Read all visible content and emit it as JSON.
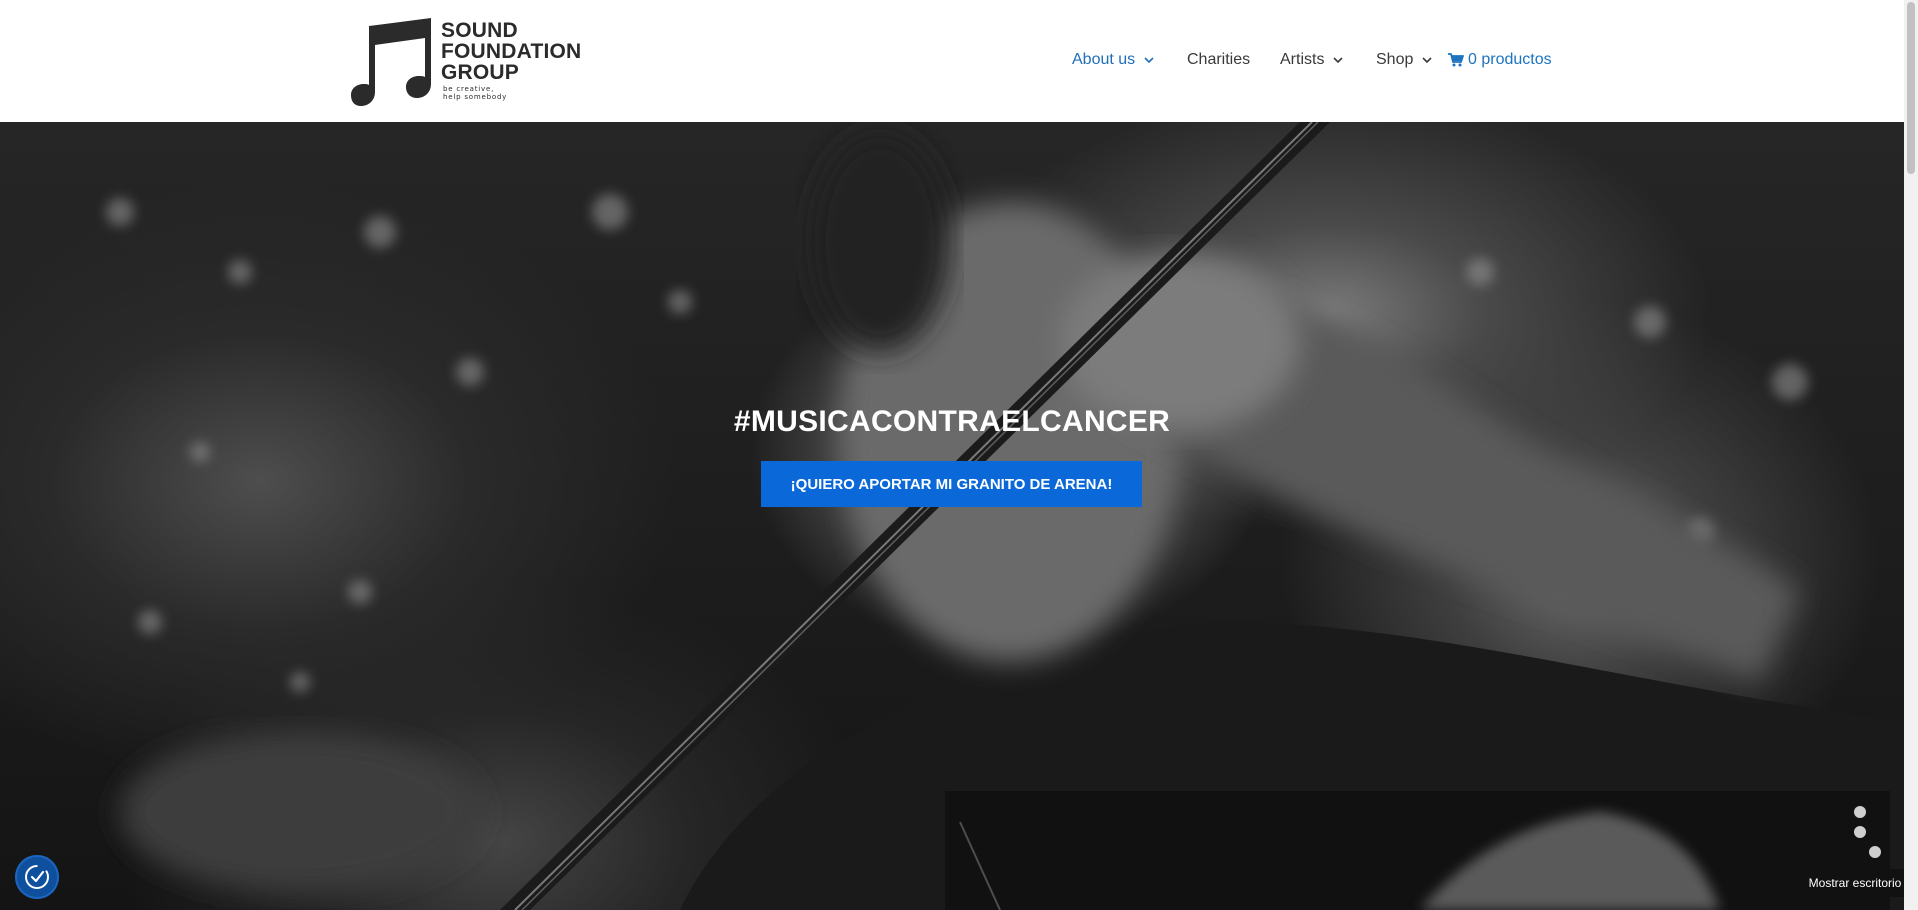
{
  "brand": {
    "name_line1": "SOUND",
    "name_line2": "FOUNDATION",
    "name_line3": "GROUP",
    "tagline_line1": "be creative,",
    "tagline_line2": "help somebody"
  },
  "nav": {
    "items": [
      {
        "label": "About us",
        "has_dropdown": true,
        "active": true
      },
      {
        "label": "Charities",
        "has_dropdown": false
      },
      {
        "label": "Artists",
        "has_dropdown": true
      },
      {
        "label": "Shop",
        "has_dropdown": true
      }
    ],
    "cart_label": "0 productos",
    "cart_icon": "shopping-cart-icon"
  },
  "hero": {
    "title": "#MUSICACONTRAELCANCER",
    "cta_label": "¡QUIERO APORTAR MI GRANITO DE ARENA!"
  },
  "widgets": {
    "cookie_icon": "cookie-consent-icon",
    "desktop_tooltip": "Mostrar escritorio"
  },
  "colors": {
    "accent": "#0a68d8",
    "nav_active": "#1e6fb8",
    "nav_text": "#3a3a3a",
    "cart": "#1e73be"
  }
}
